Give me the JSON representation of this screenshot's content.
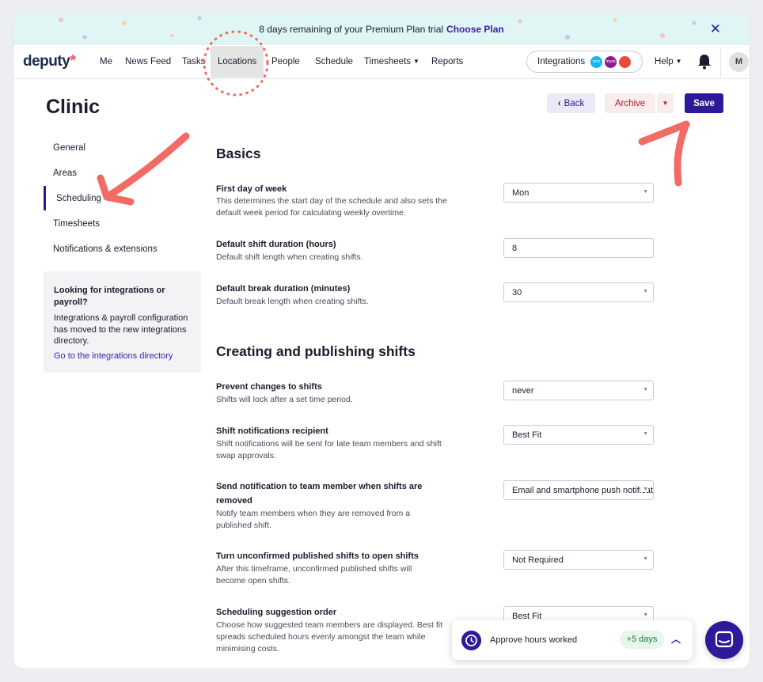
{
  "banner": {
    "message": "8 days remaining of your Premium Plan trial",
    "cta": "Choose Plan",
    "close": "✕"
  },
  "nav": {
    "logo": "deputy",
    "logo_mark": "*",
    "items": [
      {
        "label": "Me"
      },
      {
        "label": "News Feed"
      },
      {
        "label": "Tasks"
      },
      {
        "label": "Locations"
      },
      {
        "label": "People"
      },
      {
        "label": "Schedule"
      },
      {
        "label": "Timesheets"
      },
      {
        "label": "Reports"
      }
    ],
    "active": "Locations",
    "integrations": {
      "label": "Integrations",
      "badges": [
        {
          "name": "xero",
          "color": "#13b5ea"
        },
        {
          "name": "myob",
          "color": "#8c1a8c"
        },
        {
          "name": "payroll-provider",
          "color": "#e84b3c"
        }
      ]
    },
    "help": "Help",
    "avatar": "M"
  },
  "page": {
    "title": "Clinic",
    "back": "Back",
    "archive": "Archive",
    "save": "Save"
  },
  "sidebar": {
    "items": [
      {
        "label": "General"
      },
      {
        "label": "Areas"
      },
      {
        "label": "Scheduling"
      },
      {
        "label": "Timesheets"
      },
      {
        "label": "Notifications & extensions"
      }
    ],
    "active": "Scheduling",
    "info": {
      "title": "Looking for integrations or payroll?",
      "body": "Integrations & payroll configuration has moved to the new integrations directory.",
      "link": "Go to the integrations directory"
    }
  },
  "sections": [
    {
      "title": "Basics",
      "settings": [
        {
          "label": "First day of week",
          "desc": "This determines the start day of the schedule and also sets the default week period for calculating weekly overtime.",
          "value": "Mon",
          "type": "select"
        },
        {
          "label": "Default shift duration (hours)",
          "desc": "Default shift length when creating shifts.",
          "value": "8",
          "type": "input"
        },
        {
          "label": "Default break duration (minutes)",
          "desc": "Default break length when creating shifts.",
          "value": "30",
          "type": "select"
        }
      ]
    },
    {
      "title": "Creating and publishing shifts",
      "settings": [
        {
          "label": "Prevent changes to shifts",
          "desc": "Shifts will lock after a set time period.",
          "value": "never",
          "type": "select"
        },
        {
          "label": "Shift notifications recipient",
          "desc": "Shift notifications will be sent for late team members and shift swap approvals.",
          "value": "Best Fit",
          "type": "select"
        },
        {
          "label": "Send notification to team member when shifts are removed",
          "desc": "Notify team members when they are removed from a published shift.",
          "value": "Email and smartphone push notifications",
          "type": "select"
        },
        {
          "label": "Turn unconfirmed published shifts to open shifts",
          "desc": "After this timeframe, unconfirmed published shifts will become open shifts.",
          "value": "Not Required",
          "type": "select"
        },
        {
          "label": "Scheduling suggestion order",
          "desc": "Choose how suggested team members are displayed. Best fit spreads scheduled hours evenly amongst the team while minimising costs.",
          "value": "Best Fit",
          "type": "select"
        }
      ]
    }
  ],
  "widget": {
    "approve_label": "Approve hours worked",
    "badge": "+5 days"
  },
  "colors": {
    "brand": "#2c1a99",
    "annotation": "#f26b65",
    "archive_text": "#b01d2d",
    "banner_bg": "#dff6f5"
  }
}
